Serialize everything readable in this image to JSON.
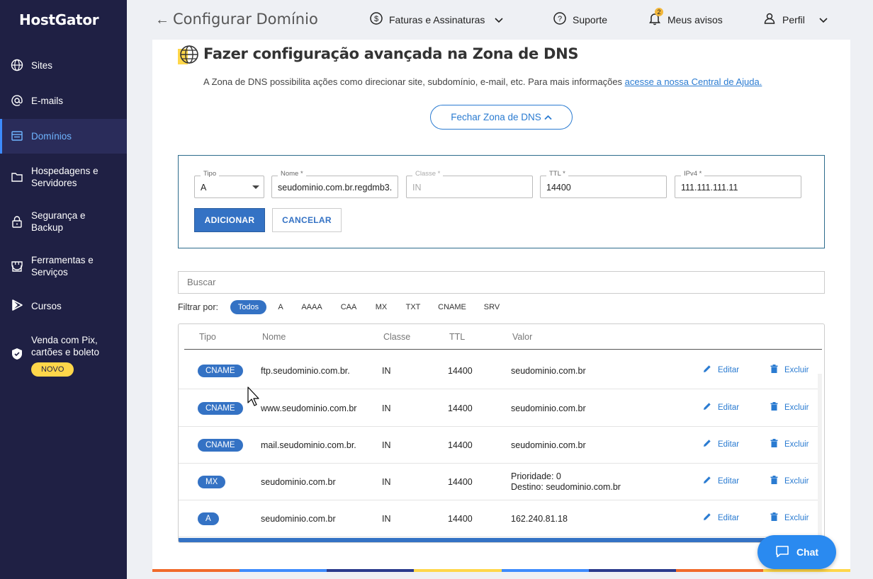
{
  "sidebar": {
    "logo": "HostGator",
    "items": [
      {
        "label": "Sites",
        "icon": "globe-icon"
      },
      {
        "label": "E-mails",
        "icon": "at-icon"
      },
      {
        "label": "Domínios",
        "icon": "domain-icon",
        "active": true
      },
      {
        "label": "Hospedagens e Servidores",
        "icon": "folder-icon"
      },
      {
        "label": "Segurança e Backup",
        "icon": "lock-icon"
      },
      {
        "label": "Ferramentas e Serviços",
        "icon": "store-icon"
      },
      {
        "label": "Cursos",
        "icon": "play-icon"
      },
      {
        "label": "Venda com Pix, cartões e boleto",
        "icon": "shield-icon"
      }
    ],
    "badge": "NOVO"
  },
  "topbar": {
    "title": "Configurar Domínio",
    "billing": "Faturas e Assinaturas",
    "support": "Suporte",
    "notifications": "Meus avisos",
    "notification_count": "2",
    "profile": "Perfil"
  },
  "dns": {
    "title": "Fazer configuração avançada na Zona de DNS",
    "description": "A Zona de DNS possibilita ações como direcionar site, subdomínio, e-mail, etc. Para mais informações",
    "help_link": "acesse a nossa Central de Ajuda.",
    "close_button": "Fechar Zona de DNS"
  },
  "form": {
    "tipo_label": "Tipo",
    "tipo_value": "A",
    "nome_label": "Nome *",
    "nome_value": "seudominio.com.br.regdmb3.",
    "classe_label": "Classe *",
    "classe_value": "IN",
    "ttl_label": "TTL *",
    "ttl_value": "14400",
    "ipv4_label": "IPv4 *",
    "ipv4_value": "111.111.111.11",
    "add_button": "ADICIONAR",
    "cancel_button": "CANCELAR"
  },
  "search": {
    "placeholder": "Buscar"
  },
  "filter": {
    "label": "Filtrar por:",
    "chips": [
      "Todos",
      "A",
      "AAAA",
      "CAA",
      "MX",
      "TXT",
      "CNAME",
      "SRV"
    ],
    "selected": "Todos"
  },
  "table": {
    "headers": {
      "tipo": "Tipo",
      "nome": "Nome",
      "classe": "Classe",
      "ttl": "TTL",
      "valor": "Valor"
    },
    "edit_label": "Editar",
    "delete_label": "Excluir",
    "rows": [
      {
        "type": "CNAME",
        "name": "ftp.seudominio.com.br.",
        "class": "IN",
        "ttl": "14400",
        "value": "seudominio.com.br"
      },
      {
        "type": "CNAME",
        "name": "www.seudominio.com.br",
        "class": "IN",
        "ttl": "14400",
        "value": "seudominio.com.br"
      },
      {
        "type": "CNAME",
        "name": "mail.seudominio.com.br.",
        "class": "IN",
        "ttl": "14400",
        "value": "seudominio.com.br"
      },
      {
        "type": "MX",
        "name": "seudominio.com.br",
        "class": "IN",
        "ttl": "14400",
        "value_line1": "Prioridade: 0",
        "value_line2_label": "Destino:",
        "value_line2": "seudominio.com.br"
      },
      {
        "type": "A",
        "name": "seudominio.com.br",
        "class": "IN",
        "ttl": "14400",
        "value": "162.240.81.18"
      }
    ]
  },
  "chat": {
    "label": "Chat"
  },
  "colors": {
    "sidebar": "#1f2044",
    "accent": "#3472c4",
    "link": "#2a7bd1",
    "badge": "#ffd74a"
  }
}
